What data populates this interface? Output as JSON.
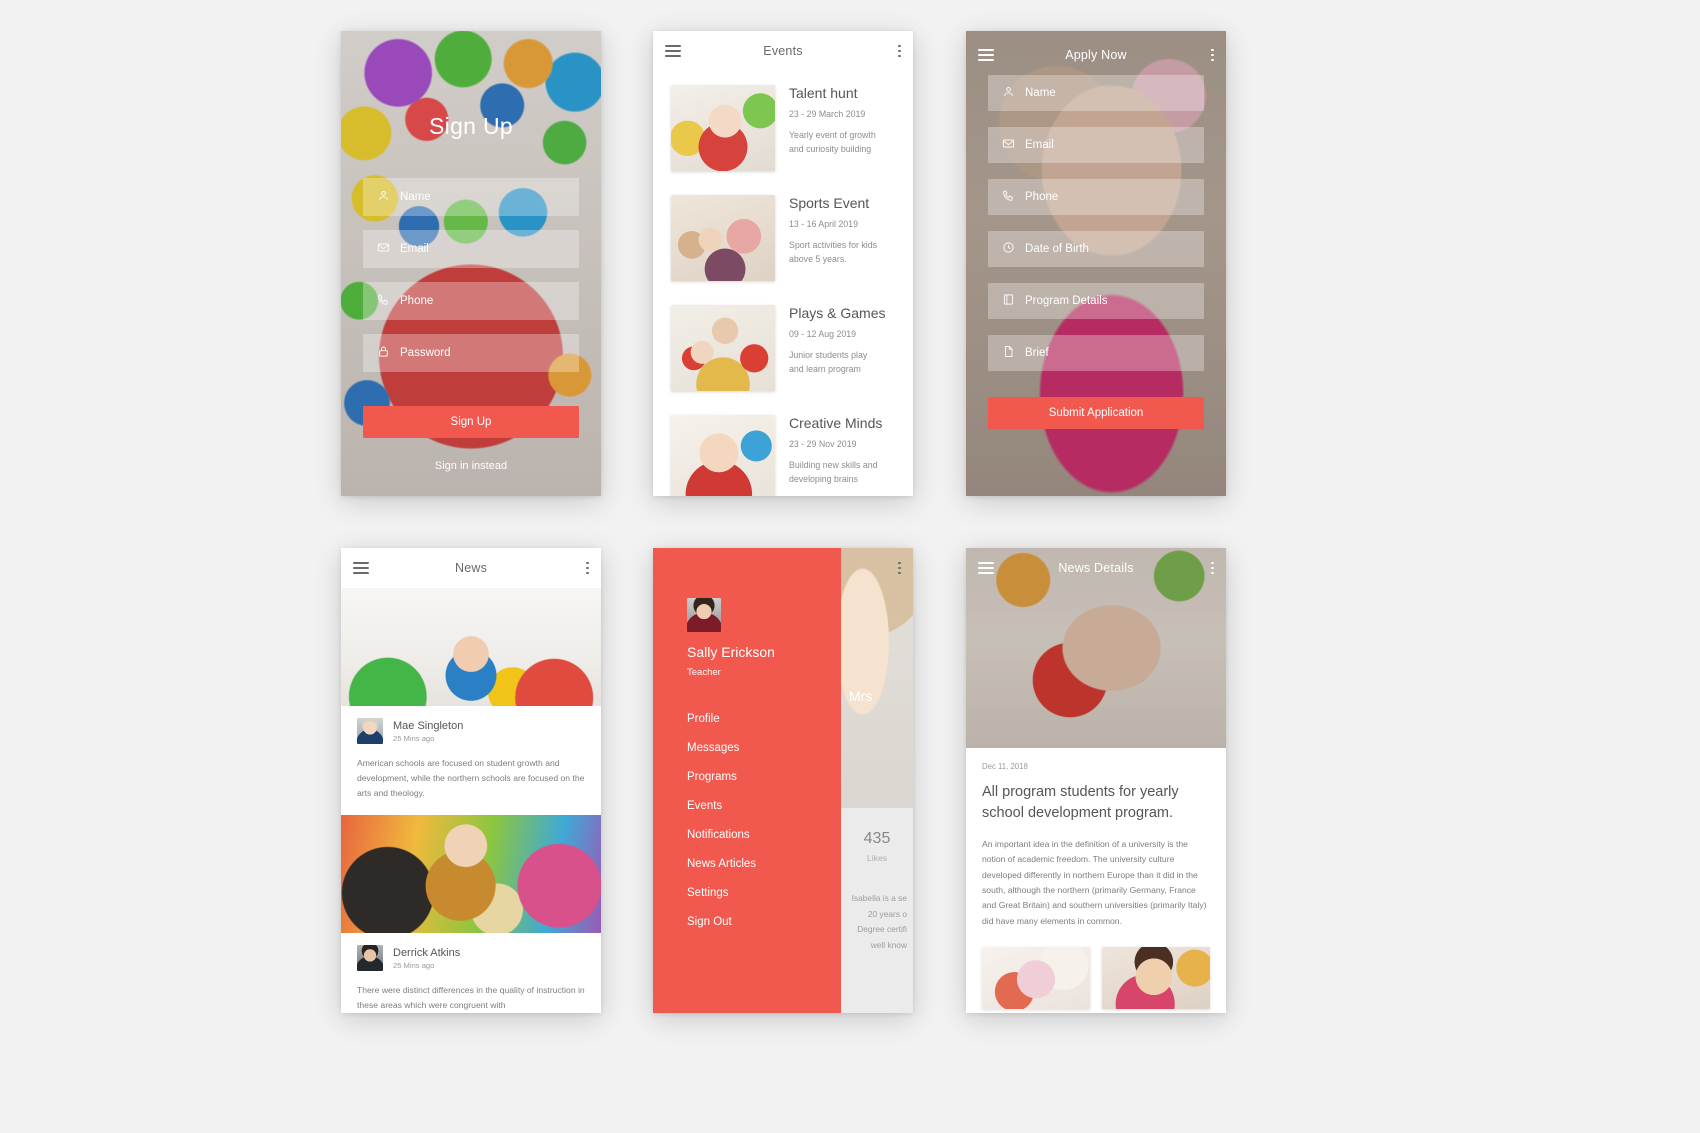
{
  "brand": {
    "accent": "#f1594f",
    "text_dark": "#555555",
    "text_muted": "#8d8d8d"
  },
  "signup": {
    "title": "Sign Up",
    "fields": [
      {
        "icon": "person-icon",
        "placeholder": "Name"
      },
      {
        "icon": "envelope-icon",
        "placeholder": "Email"
      },
      {
        "icon": "phone-icon",
        "placeholder": "Phone"
      },
      {
        "icon": "lock-icon",
        "placeholder": "Password"
      }
    ],
    "submit_label": "Sign Up",
    "secondary_label": "Sign in instead"
  },
  "events": {
    "appbar": {
      "title": "Events",
      "menu_icon": "hamburger-icon",
      "overflow_icon": "kebab-icon"
    },
    "items": [
      {
        "title": "Talent hunt",
        "date": "23 - 29 March 2019",
        "desc_line1": "Yearly event of growth",
        "desc_line2": "and curiosity building"
      },
      {
        "title": "Sports Event",
        "date": "13 - 16 April 2019",
        "desc_line1": "Sport activities for kids",
        "desc_line2": "above 5 years."
      },
      {
        "title": "Plays & Games",
        "date": "09 - 12 Aug 2019",
        "desc_line1": "Junior students play",
        "desc_line2": "and learn program"
      },
      {
        "title": "Creative Minds",
        "date": "23 - 29 Nov 2019",
        "desc_line1": "Building new skills and",
        "desc_line2": "developing brains"
      }
    ]
  },
  "apply": {
    "appbar": {
      "title": "Apply Now",
      "menu_icon": "hamburger-icon",
      "overflow_icon": "kebab-icon"
    },
    "fields": [
      {
        "icon": "person-icon",
        "placeholder": "Name"
      },
      {
        "icon": "envelope-icon",
        "placeholder": "Email"
      },
      {
        "icon": "phone-icon",
        "placeholder": "Phone"
      },
      {
        "icon": "clock-icon",
        "placeholder": "Date of Birth"
      },
      {
        "icon": "book-icon",
        "placeholder": "Program Details"
      },
      {
        "icon": "document-icon",
        "placeholder": "Brief"
      }
    ],
    "submit_label": "Submit Application"
  },
  "news": {
    "appbar": {
      "title": "News",
      "menu_icon": "hamburger-icon",
      "overflow_icon": "kebab-icon"
    },
    "articles": [
      {
        "author": "Mae Singleton",
        "time": "25 Mins ago",
        "body": "American schools are focused on student growth and development, while the northern schools are focused on the arts and theology."
      },
      {
        "author": "Derrick Atkins",
        "time": "25 Mins ago",
        "body": "There were distinct differences in the quality of instruction in these areas which were congruent with"
      }
    ]
  },
  "drawer": {
    "user_name": "Sally Erickson",
    "user_role": "Teacher",
    "menu": [
      "Profile",
      "Messages",
      "Programs",
      "Events",
      "Notifications",
      "News Articles",
      "Settings",
      "Sign Out"
    ],
    "behind": {
      "name_fragment": "Mrs",
      "likes_count": "435",
      "likes_label": "Likes",
      "bio_line1": "Isabella is a se",
      "bio_line2": "20 years o",
      "bio_line3": "Degree certifi",
      "bio_line4": "well know"
    },
    "overflow_icon": "kebab-icon"
  },
  "detail": {
    "appbar": {
      "title": "News Details",
      "menu_icon": "hamburger-icon",
      "overflow_icon": "kebab-icon"
    },
    "date": "Dec 11, 2018",
    "headline": "All program students for yearly school development program.",
    "body": "An important idea in the definition of a university is the notion of academic freedom. The university culture developed differently in northern Europe than it did in the south, although the northern (primarily Germany, France and Great Britain) and southern universities (primarily Italy) did have many elements in common.",
    "gallery": [
      "gallery-image-1",
      "gallery-image-2"
    ]
  }
}
